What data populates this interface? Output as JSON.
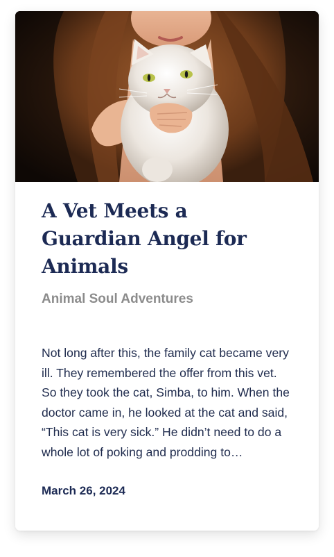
{
  "card": {
    "image_alt": "Girl with long curly hair holding a fluffy white cat",
    "title": "A Vet Meets a Guardian Angel for Animals",
    "category": "Animal Soul Adventures",
    "excerpt": "Not long after this, the family cat became very ill. They remembered the offer from this vet. So they took the cat, Simba, to him. When the doctor came in, he looked at the cat and said, “This cat is very sick.” He didn’t need to do a whole lot of poking and prodding to…",
    "date": "March 26, 2024"
  },
  "colors": {
    "title": "#1c2a54",
    "category": "#8c8c8c",
    "body": "#1f2b4d"
  }
}
